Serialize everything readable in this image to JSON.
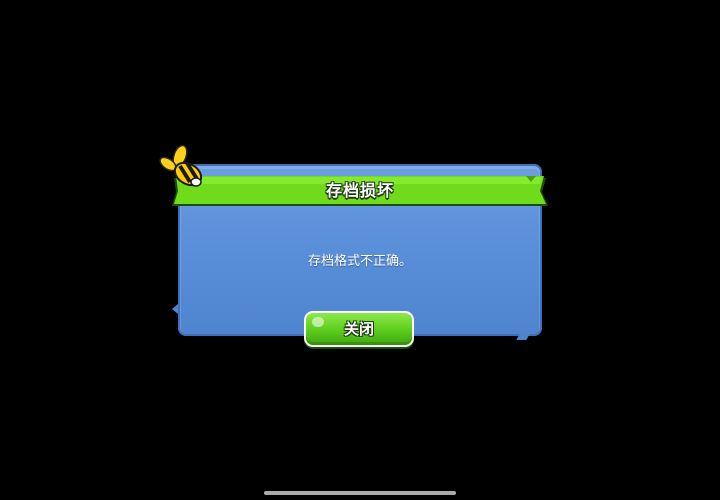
{
  "dialog": {
    "title": "存档损坏",
    "message": "存档格式不正确。",
    "close_label": "关闭"
  },
  "icons": {
    "mascot": "bee-icon"
  },
  "colors": {
    "background": "#000000",
    "panel": "#5a8fd9",
    "ribbon": "#6fdb1a",
    "button": "#5fcf1f",
    "text": "#ffffff"
  }
}
